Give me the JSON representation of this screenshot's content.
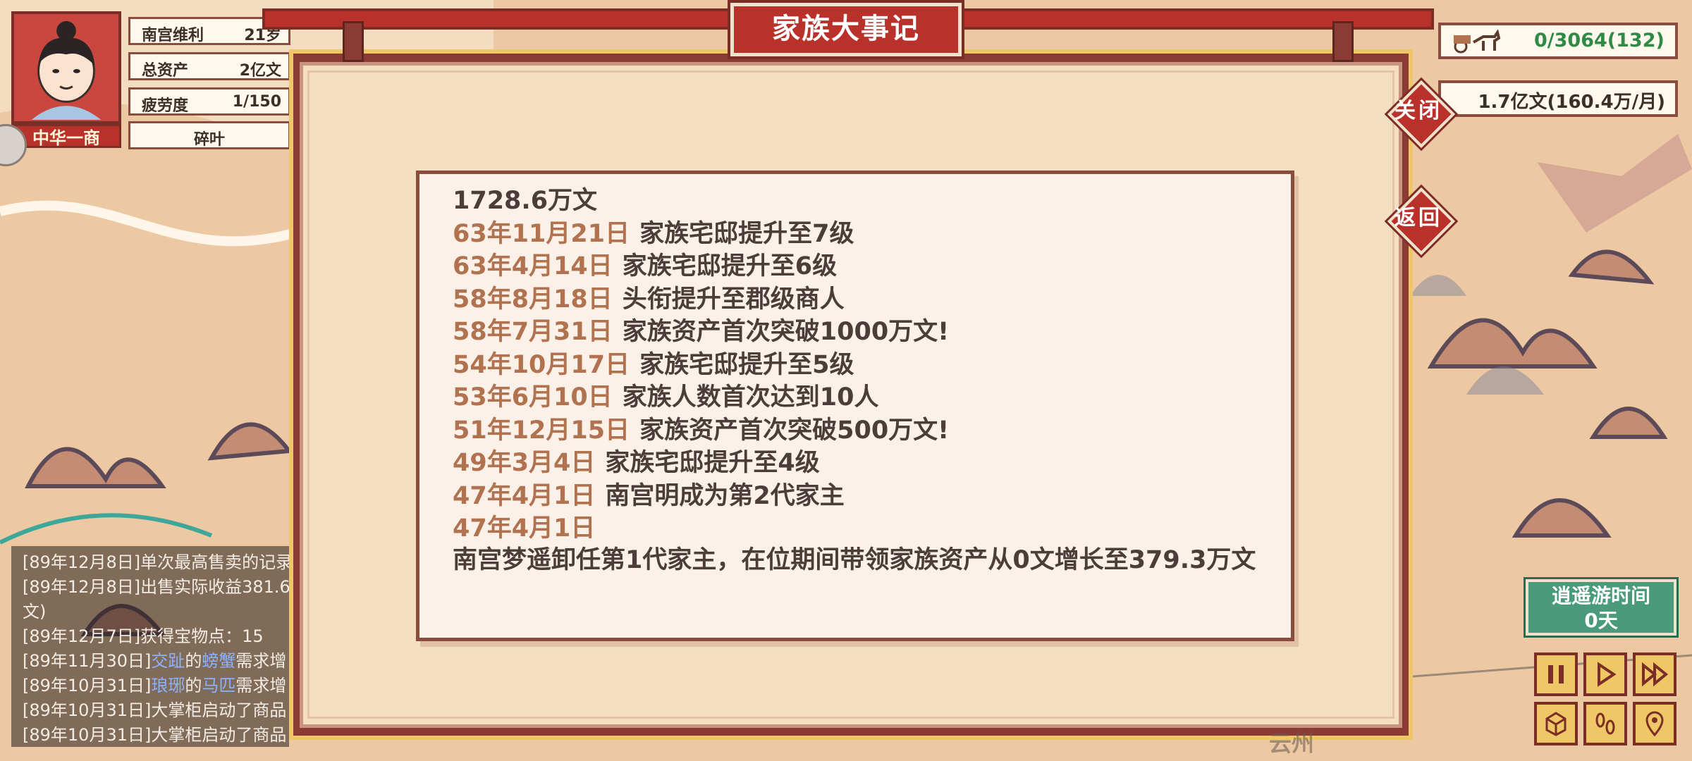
{
  "player": {
    "badge": "中华一商",
    "stats": [
      {
        "label": "南宫维利",
        "value": "21岁"
      },
      {
        "label": "总资产",
        "value": "2亿文"
      },
      {
        "label": "疲劳度",
        "value": "1/150"
      }
    ],
    "server": "碎叶"
  },
  "top_right": {
    "transport": "0/3064(132)",
    "income": "1.7亿文(160.4万/月)"
  },
  "dialog": {
    "title": "家族大事记",
    "close_label": "关闭",
    "back_label": "返回",
    "header_line": "1728.6万文",
    "events": [
      {
        "date": "63年11月21日",
        "text": "家族宅邸提升至7级"
      },
      {
        "date": "63年4月14日",
        "text": "家族宅邸提升至6级"
      },
      {
        "date": "58年8月18日",
        "text": "头衔提升至郡级商人"
      },
      {
        "date": "58年7月31日",
        "text": "家族资产首次突破1000万文!"
      },
      {
        "date": "54年10月17日",
        "text": "家族宅邸提升至5级"
      },
      {
        "date": "53年6月10日",
        "text": "家族人数首次达到10人"
      },
      {
        "date": "51年12月15日",
        "text": "家族资产首次突破500万文!"
      },
      {
        "date": "49年3月4日",
        "text": "家族宅邸提升至4级"
      },
      {
        "date": "47年4月1日",
        "text": "南宫明成为第2代家主"
      },
      {
        "date": "47年4月1日",
        "text": ""
      }
    ],
    "last_event_text": "南宫梦遥卸任第1代家主，在位期间带领家族资产从0文增长至379.3万文"
  },
  "chat_log": {
    "lines": [
      "[89年12月8日]单次最高售卖的记录",
      "[89年12月8日]出售实际收益381.6",
      "文)",
      "[89年12月7日]获得宝物点：15"
    ],
    "line5_prefix": "[89年11月30日]",
    "line5_link1": "交趾",
    "line5_mid": "的",
    "line5_link2": "螃蟹",
    "line5_suffix": "需求增",
    "line6_prefix": "[89年10月31日]",
    "line6_link1": "琅琊",
    "line6_mid": "的",
    "line6_link2": "马匹",
    "line6_suffix": "需求增",
    "line7": "[89年10月31日]大掌柜启动了商品",
    "line8": "[89年10月31日]大掌柜启动了商品"
  },
  "time_panel": {
    "title": "逍遥游时间",
    "value": "0天"
  },
  "map_label": "云州",
  "colors": {
    "accent_red": "#b8322b",
    "date_brown": "#b0724f",
    "time_green": "#4a9b7b",
    "control_gold": "#f0c766"
  }
}
